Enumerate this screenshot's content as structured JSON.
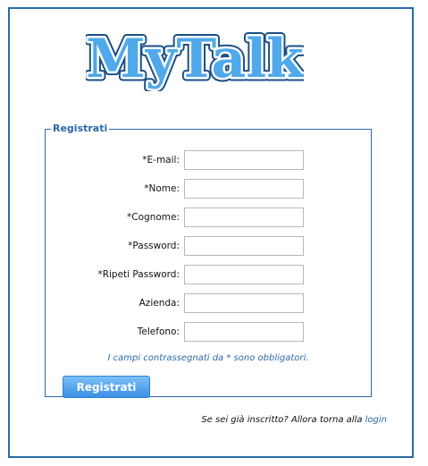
{
  "logo": {
    "text": "MyTalk",
    "fill_color": "#4fa9ea",
    "outline_color": "#1b4f86"
  },
  "form": {
    "legend": "Registrati",
    "fields": [
      {
        "label": "*E-mail:",
        "value": ""
      },
      {
        "label": "*Nome:",
        "value": ""
      },
      {
        "label": "*Cognome:",
        "value": ""
      },
      {
        "label": "*Password:",
        "value": ""
      },
      {
        "label": "*Ripeti Password:",
        "value": ""
      },
      {
        "label": "Azienda:",
        "value": ""
      },
      {
        "label": "Telefono:",
        "value": ""
      }
    ],
    "required_note": "I campi contrassegnati da * sono obbligatori.",
    "submit_label": "Registrati"
  },
  "footer": {
    "prompt": "Se sei già inscritto? Allora torna alla ",
    "login_link": "login"
  },
  "colors": {
    "accent": "#2a6aa8",
    "button": "#3b8fe6"
  }
}
